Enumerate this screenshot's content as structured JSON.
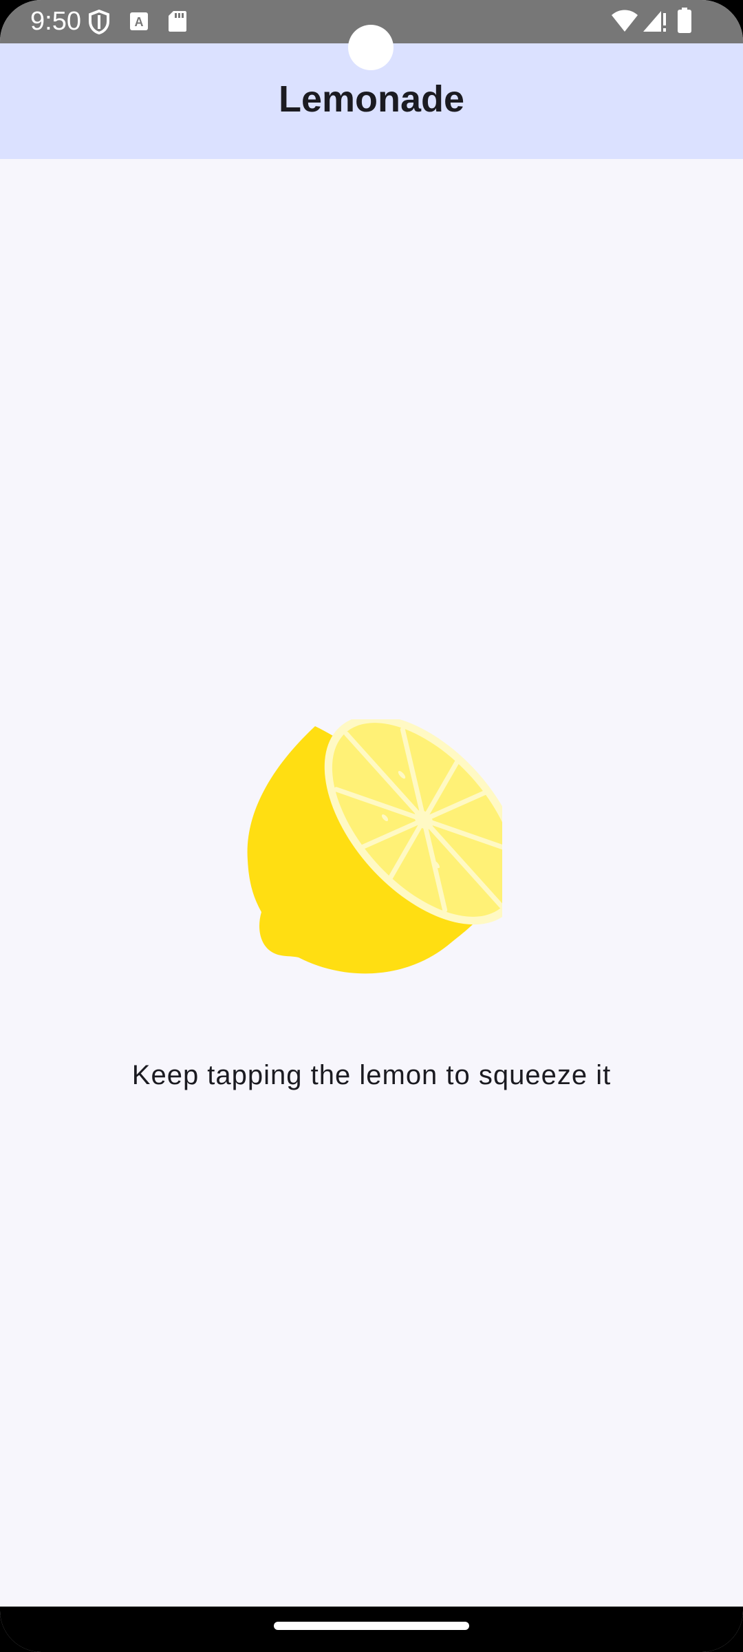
{
  "status_bar": {
    "time": "9:50",
    "left_icons": [
      "shield-icon",
      "text-a-icon",
      "sd-card-icon"
    ],
    "right_icons": [
      "wifi-icon",
      "signal-icon",
      "battery-icon"
    ]
  },
  "app_bar": {
    "title": "Lemonade",
    "background": "#dbe1ff"
  },
  "main": {
    "image_name": "lemon-squeeze-icon",
    "instruction": "Keep tapping the lemon to squeeze it",
    "background": "#f7f6fc"
  },
  "colors": {
    "lemon_peel": "#ffde12",
    "lemon_flesh": "#fff176",
    "lemon_rind": "#fff9c4"
  }
}
